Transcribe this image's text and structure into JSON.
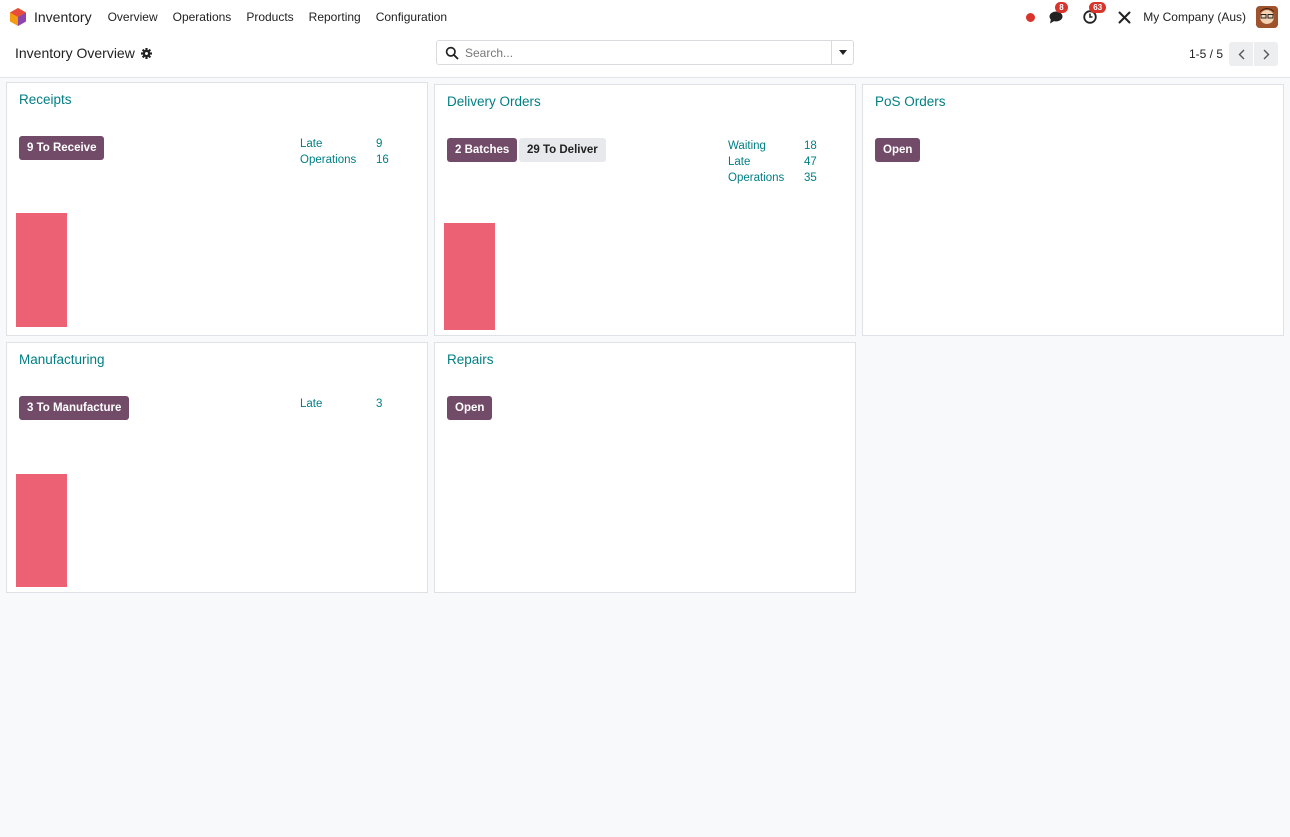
{
  "navbar": {
    "app_name": "Inventory",
    "menu": [
      "Overview",
      "Operations",
      "Products",
      "Reporting",
      "Configuration"
    ],
    "messages_count": "8",
    "activities_count": "63",
    "company": "My Company (Aus)",
    "icons": [
      "app-logo",
      "record-dot",
      "chat-icon",
      "clock-icon",
      "tools-icon",
      "avatar"
    ]
  },
  "control_panel": {
    "title": "Inventory Overview",
    "search_placeholder": "Search...",
    "pager": "1-5 / 5"
  },
  "cards": {
    "receipts": {
      "title": "Receipts",
      "button": "9 To Receive",
      "stats": [
        {
          "label": "Late",
          "value": "9"
        },
        {
          "label": "Operations",
          "value": "16"
        }
      ]
    },
    "delivery": {
      "title": "Delivery Orders",
      "buttons": [
        "2 Batches",
        "29 To Deliver"
      ],
      "stats": [
        {
          "label": "Waiting",
          "value": "18"
        },
        {
          "label": "Late",
          "value": "47"
        },
        {
          "label": "Operations",
          "value": "35"
        }
      ]
    },
    "pos": {
      "title": "PoS Orders",
      "button": "Open"
    },
    "manufacturing": {
      "title": "Manufacturing",
      "button": "3 To Manufacture",
      "stats": [
        {
          "label": "Late",
          "value": "3"
        }
      ]
    },
    "repairs": {
      "title": "Repairs",
      "button": "Open"
    }
  },
  "colors": {
    "brand": "#714b67",
    "teal": "#017e84",
    "bar": "#ed6174",
    "badge": "#d9342b"
  }
}
